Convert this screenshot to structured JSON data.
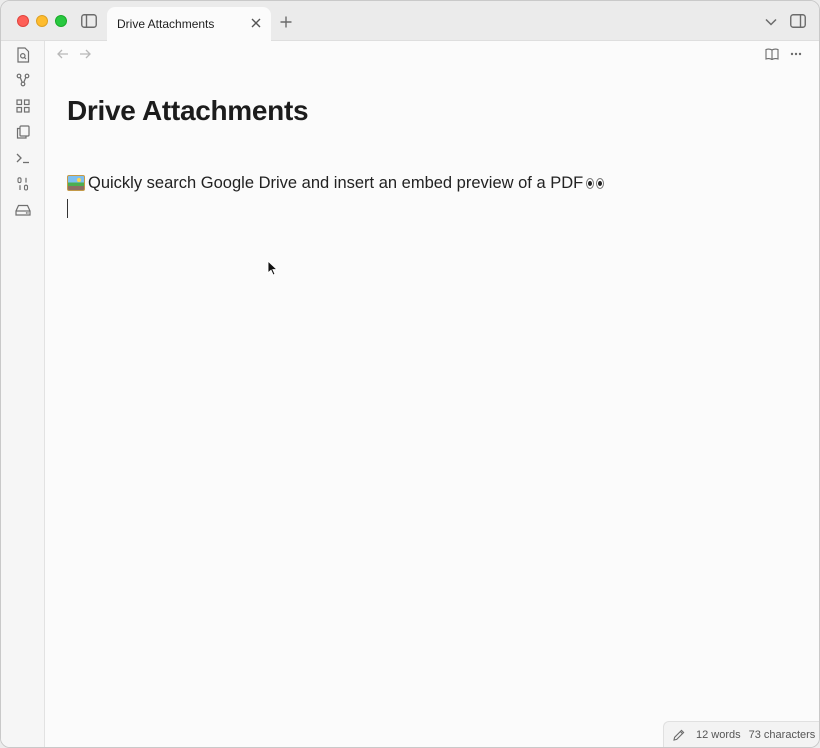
{
  "titlebar": {
    "tab_title": "Drive Attachments",
    "icons": [
      "sidebar-toggle-icon",
      "close-icon",
      "plus-icon",
      "chevron-down-icon",
      "right-sidebar-icon"
    ]
  },
  "ribbon": {
    "items": [
      "search-file-icon",
      "graph-icon",
      "grid-icon",
      "copy-icon",
      "terminal-icon",
      "binary-icon",
      "drive-icon"
    ]
  },
  "view_header": {
    "icons": [
      "arrow-left-icon",
      "arrow-right-icon",
      "book-open-icon",
      "more-horizontal-icon"
    ]
  },
  "note": {
    "title": "Drive Attachments",
    "line_emoji": "framed-picture",
    "line_text": " Quickly search Google Drive and insert an embed preview of a PDF ",
    "line_end_emoji": "eyes"
  },
  "status_bar": {
    "words": "12 words",
    "characters": "73 characters"
  },
  "colors": {
    "close": "#fe5f57",
    "minimize": "#febc2e",
    "zoom": "#28c840",
    "background": "#fbfbfb",
    "ribbon": "#f6f6f6"
  }
}
